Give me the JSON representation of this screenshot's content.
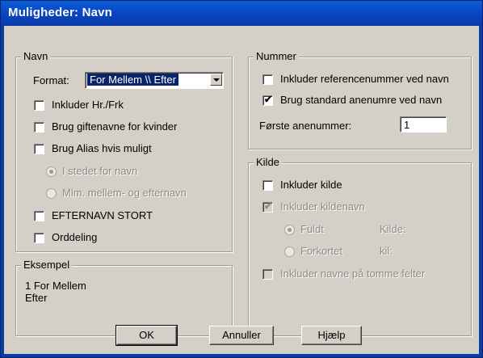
{
  "window": {
    "title": "Muligheder: Navn"
  },
  "navn": {
    "legend": "Navn",
    "format_label": "Format:",
    "format_value": "For Mellem \\\\ Efter",
    "inkluder_hr": "Inkluder Hr./Frk",
    "brug_giftenavne": "Brug giftenavne for kvinder",
    "brug_alias": "Brug Alias hvis muligt",
    "i_stedet": "I stedet for navn",
    "mlm": "Mlm. mellem- og efternavn",
    "efternavn_stort": "EFTERNAVN STORT",
    "orddeling": "Orddeling"
  },
  "eksempel": {
    "legend": "Eksempel",
    "line1": "1 For Mellem",
    "line2": "Efter"
  },
  "nummer": {
    "legend": "Nummer",
    "inkluder_ref": "Inkluder referencenummer ved navn",
    "brug_standard": "Brug standard anenumre ved navn",
    "forste_label": "Første anenummer:",
    "forste_value": "1"
  },
  "kilde": {
    "legend": "Kilde",
    "inkluder_kilde": "Inkluder kilde",
    "inkluder_kildenavn": "Inkluder kildenavn",
    "fuldt": "Fuldt",
    "kilde_long": "Kilde:",
    "forkortet": "Forkortet",
    "kilde_short": "kil:",
    "tomme": "Inkluder navne på tomme felter"
  },
  "buttons": {
    "ok": "OK",
    "annuller": "Annuller",
    "hjaelp": "Hjælp"
  },
  "icons": {
    "checkmark": "check-icon",
    "dropdown": "chevron-down-icon"
  },
  "colors": {
    "titlebar": "#0a47c4",
    "dialog": "#d4d0c8",
    "selection": "#0a246a"
  }
}
